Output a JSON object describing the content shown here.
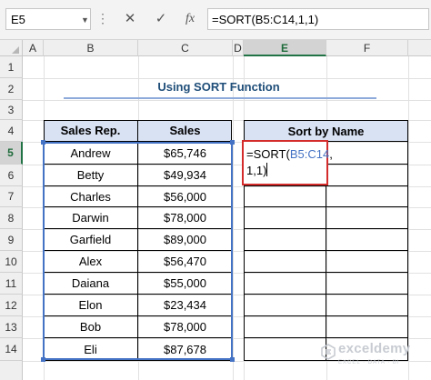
{
  "formula_bar": {
    "name_box": "E5",
    "cancel_icon": "✕",
    "enter_icon": "✓",
    "fx_label": "fx",
    "formula": "=SORT(B5:C14,1,1)"
  },
  "columns": [
    "A",
    "B",
    "C",
    "D",
    "E",
    "F"
  ],
  "rows": [
    "1",
    "2",
    "3",
    "4",
    "5",
    "6",
    "7",
    "8",
    "9",
    "10",
    "11",
    "12",
    "13",
    "14"
  ],
  "selected_column": "E",
  "selected_row": "5",
  "title": "Using SORT Function",
  "table": {
    "headers": [
      "Sales Rep.",
      "Sales"
    ],
    "rows": [
      [
        "Andrew",
        "$65,746"
      ],
      [
        "Betty",
        "$49,934"
      ],
      [
        "Charles",
        "$56,000"
      ],
      [
        "Darwin",
        "$78,000"
      ],
      [
        "Garfield",
        "$89,000"
      ],
      [
        "Alex",
        "$56,470"
      ],
      [
        "Daiana",
        "$55,000"
      ],
      [
        "Elon",
        "$23,434"
      ],
      [
        "Bob",
        "$78,000"
      ],
      [
        "Eli",
        "$87,678"
      ]
    ]
  },
  "sort_table": {
    "header": "Sort by Name"
  },
  "editing": {
    "prefix": "=SORT(",
    "ref": "B5:C14",
    "line1_suffix": ",",
    "line2": "1,1)"
  },
  "watermark": {
    "name": "exceldemy",
    "tagline": "EXCEL · DATA · BI"
  },
  "colors": {
    "accent_green": "#217346",
    "range_blue": "#4472c4",
    "header_fill": "#d9e2f3",
    "active_border": "#d42b2b",
    "title_color": "#1f4e79"
  }
}
